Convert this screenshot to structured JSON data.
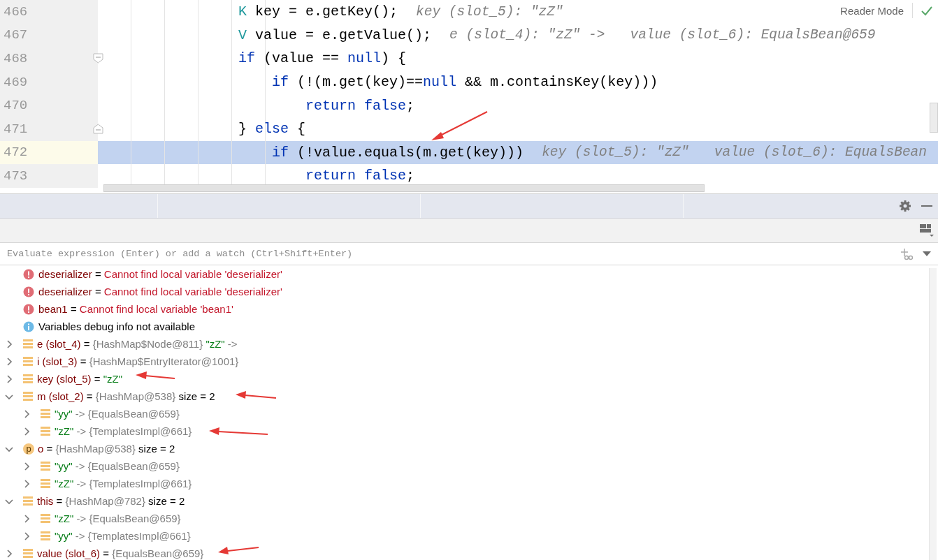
{
  "editor": {
    "reader_mode": "Reader Mode",
    "lines": [
      {
        "number": "466",
        "current": false,
        "code": [
          {
            "text": "                K",
            "kind": "type"
          },
          {
            "text": " key = e.getKey();",
            "kind": "plain"
          }
        ],
        "hints": [
          "key (slot_5): \"zZ\""
        ]
      },
      {
        "number": "467",
        "current": false,
        "code": [
          {
            "text": "                V",
            "kind": "type"
          },
          {
            "text": " value = e.getValue();",
            "kind": "plain"
          }
        ],
        "hints": [
          "e (slot_4): \"zZ\" ->",
          "value (slot_6): EqualsBean@659"
        ]
      },
      {
        "number": "468",
        "current": false,
        "fold": {
          "kind": "start"
        },
        "code": [
          {
            "text": "                if",
            "kind": "keyword"
          },
          {
            "text": " (value == ",
            "kind": "plain"
          },
          {
            "text": "null",
            "kind": "keyword"
          },
          {
            "text": ") {",
            "kind": "plain"
          }
        ]
      },
      {
        "number": "469",
        "current": false,
        "code": [
          {
            "text": "                    if",
            "kind": "keyword"
          },
          {
            "text": " (!(m.get(key)==",
            "kind": "plain"
          },
          {
            "text": "null",
            "kind": "keyword"
          },
          {
            "text": " && m.containsKey(key)))",
            "kind": "plain"
          }
        ]
      },
      {
        "number": "470",
        "current": false,
        "code": [
          {
            "text": "                        return false",
            "kind": "keyword"
          },
          {
            "text": ";",
            "kind": "plain"
          }
        ]
      },
      {
        "number": "471",
        "current": false,
        "fold": {
          "kind": "end"
        },
        "code": [
          {
            "text": "                } ",
            "kind": "plain"
          },
          {
            "text": "else",
            "kind": "keyword"
          },
          {
            "text": " {",
            "kind": "plain"
          }
        ]
      },
      {
        "number": "472",
        "current": true,
        "code": [
          {
            "text": "                    if",
            "kind": "keyword"
          },
          {
            "text": " (!value.equals(m.get(key)))",
            "kind": "plain"
          }
        ],
        "hints": [
          "key (slot_5): \"zZ\"",
          "value (slot_6): EqualsBean"
        ]
      },
      {
        "number": "473",
        "current": false,
        "code": [
          {
            "text": "                        return false",
            "kind": "keyword"
          },
          {
            "text": ";",
            "kind": "plain"
          }
        ]
      }
    ]
  },
  "debugger": {
    "evaluate": {
      "placeholder": "Evaluate expression (Enter) or add a watch (Ctrl+Shift+Enter)"
    },
    "variables": [
      {
        "kind": "error",
        "name": "deserializer",
        "separator": "=",
        "value": [
          {
            "text": "Cannot find local variable 'deserializer'",
            "kind": "error"
          }
        ]
      },
      {
        "kind": "error",
        "name": "deserializer",
        "separator": "=",
        "value": [
          {
            "text": "Cannot find local variable 'deserializer'",
            "kind": "error"
          }
        ]
      },
      {
        "kind": "error",
        "name": "bean1",
        "separator": "=",
        "value": [
          {
            "text": "Cannot find local variable 'bean1'",
            "kind": "error"
          }
        ]
      },
      {
        "kind": "info",
        "value": [
          {
            "text": "Variables debug info not available",
            "kind": "plain"
          }
        ]
      },
      {
        "kind": "variable",
        "expanded": false,
        "name": "e (slot_4)",
        "separator": "=",
        "value": [
          {
            "text": "{HashMap$Node@811}",
            "kind": "ref"
          },
          {
            "text": "\"zZ\"",
            "kind": "string"
          },
          {
            "text": "->",
            "kind": "ref"
          }
        ]
      },
      {
        "kind": "variable",
        "expanded": false,
        "name": "i (slot_3)",
        "separator": "=",
        "value": [
          {
            "text": "{HashMap$EntryIterator@1001}",
            "kind": "ref"
          }
        ]
      },
      {
        "kind": "variable",
        "expanded": false,
        "name": "key (slot_5)",
        "separator": "=",
        "value": [
          {
            "text": "\"zZ\"",
            "kind": "string"
          }
        ]
      },
      {
        "kind": "variable",
        "expanded": true,
        "name": "m (slot_2)",
        "separator": "=",
        "value": [
          {
            "text": "{HashMap@538}",
            "kind": "ref"
          },
          {
            "text": "size = 2",
            "kind": "plain"
          }
        ],
        "children": [
          {
            "kind": "variable",
            "expanded": false,
            "value": [
              {
                "text": "\"yy\"",
                "kind": "string"
              },
              {
                "text": "-> {EqualsBean@659}",
                "kind": "ref"
              }
            ]
          },
          {
            "kind": "variable",
            "expanded": false,
            "value": [
              {
                "text": "\"zZ\"",
                "kind": "string"
              },
              {
                "text": "-> {TemplatesImpl@661}",
                "kind": "ref"
              }
            ]
          }
        ]
      },
      {
        "kind": "parameter",
        "badge": "p",
        "expanded": true,
        "name": "o",
        "separator": "=",
        "value": [
          {
            "text": "{HashMap@538}",
            "kind": "ref"
          },
          {
            "text": "size = 2",
            "kind": "plain"
          }
        ],
        "children": [
          {
            "kind": "variable",
            "expanded": false,
            "value": [
              {
                "text": "\"yy\"",
                "kind": "string"
              },
              {
                "text": "-> {EqualsBean@659}",
                "kind": "ref"
              }
            ]
          },
          {
            "kind": "variable",
            "expanded": false,
            "value": [
              {
                "text": "\"zZ\"",
                "kind": "string"
              },
              {
                "text": "-> {TemplatesImpl@661}",
                "kind": "ref"
              }
            ]
          }
        ]
      },
      {
        "kind": "variable",
        "expanded": true,
        "name": "this",
        "separator": "=",
        "value": [
          {
            "text": "{HashMap@782}",
            "kind": "ref"
          },
          {
            "text": "size = 2",
            "kind": "plain"
          }
        ],
        "children": [
          {
            "kind": "variable",
            "expanded": false,
            "value": [
              {
                "text": "\"zZ\"",
                "kind": "string"
              },
              {
                "text": "-> {EqualsBean@659}",
                "kind": "ref"
              }
            ]
          },
          {
            "kind": "variable",
            "expanded": false,
            "value": [
              {
                "text": "\"yy\"",
                "kind": "string"
              },
              {
                "text": "-> {TemplatesImpl@661}",
                "kind": "ref"
              }
            ]
          }
        ]
      },
      {
        "kind": "variable",
        "expanded": false,
        "name": "value (slot_6)",
        "separator": "=",
        "value": [
          {
            "text": "{EqualsBean@659}",
            "kind": "ref"
          }
        ]
      }
    ]
  }
}
